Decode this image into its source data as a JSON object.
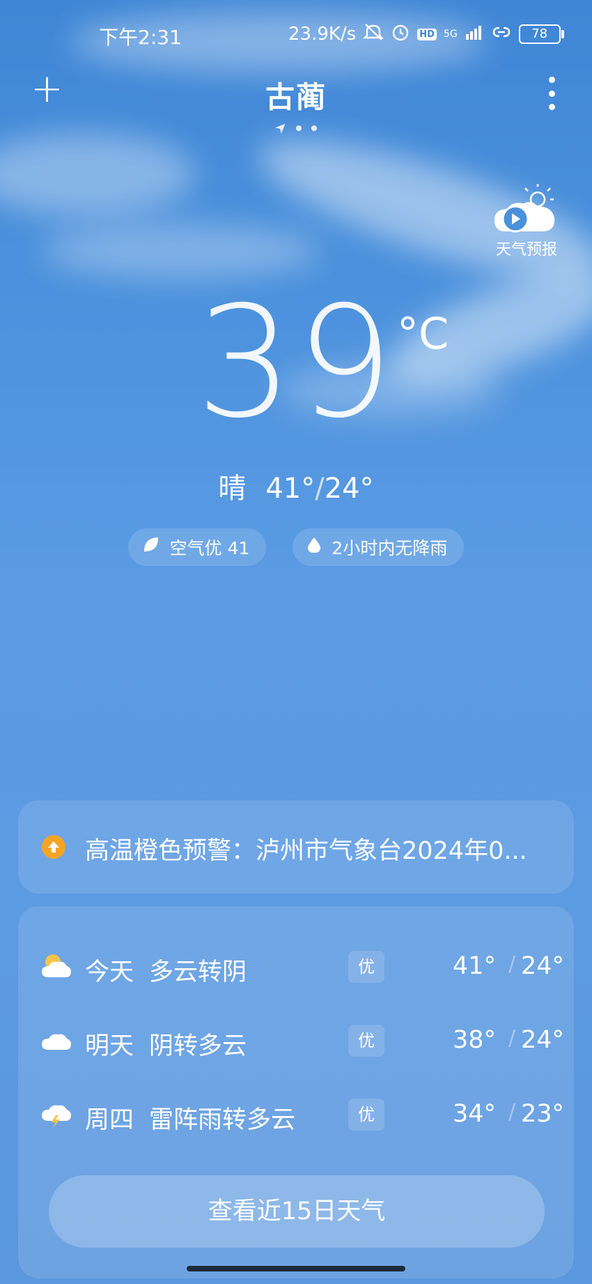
{
  "status_bar": {
    "time": "下午2:31",
    "net_speed": "23.9K/s",
    "hd_label": "HD",
    "net_type": "5G",
    "battery": "78"
  },
  "header": {
    "add_label": "+",
    "city": "古蔺"
  },
  "forecast_button": {
    "label": "天气预报"
  },
  "current": {
    "temperature": "39",
    "unit": "°C",
    "condition": "晴",
    "high": "41°",
    "low": "24°"
  },
  "chips": {
    "air_quality": "空气优 41",
    "precipitation": "2小时内无降雨"
  },
  "alert": {
    "text": "高温橙色预警：泸州市气象台2024年0...",
    "color": "#f5a524"
  },
  "forecast": [
    {
      "day": "今天",
      "desc": "多云转阴",
      "aqi": "优",
      "hi": "41°",
      "lo": "24°",
      "icon": "partly-cloudy-icon"
    },
    {
      "day": "明天",
      "desc": "阴转多云",
      "aqi": "优",
      "hi": "38°",
      "lo": "24°",
      "icon": "cloudy-icon"
    },
    {
      "day": "周四",
      "desc": "雷阵雨转多云",
      "aqi": "优",
      "hi": "34°",
      "lo": "23°",
      "icon": "thunderstorm-icon"
    }
  ],
  "separator": "/",
  "view_15_days": "查看近15日天气"
}
